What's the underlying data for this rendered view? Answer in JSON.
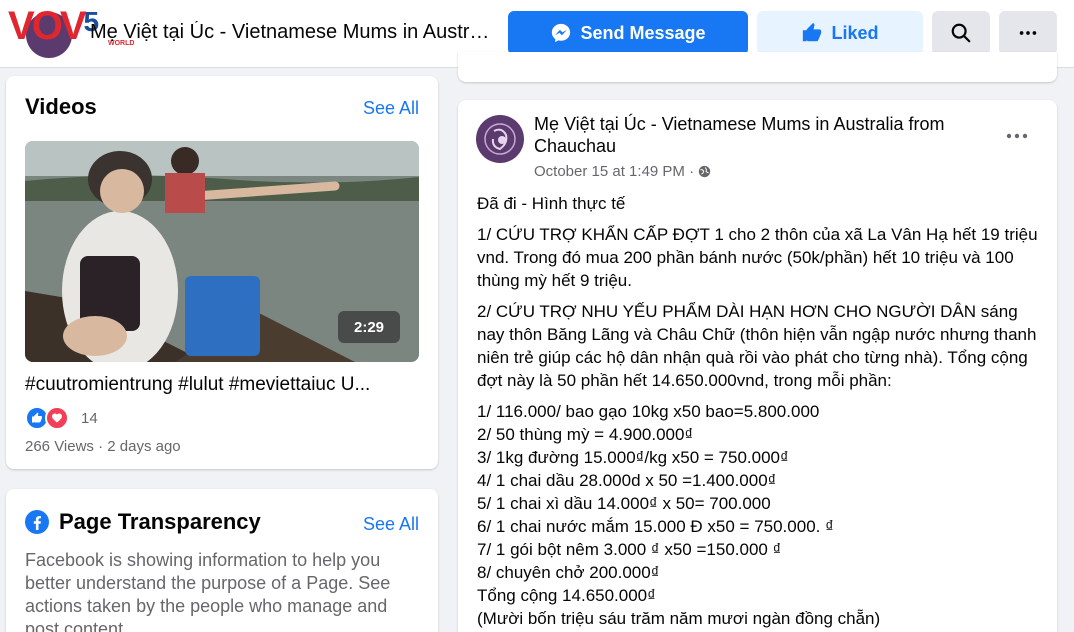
{
  "header": {
    "logo": {
      "part1": "V",
      "part2": "O",
      "part3": "V",
      "part4": "5",
      "sub": "WORLD"
    },
    "page_name": "Mẹ Việt tại Úc - Vietnamese Mums in Australia from Chauchau",
    "send_message_label": "Send Message",
    "liked_label": "Liked",
    "colors": {
      "primary": "#1877f2",
      "liked_bg": "#e7f3ff"
    }
  },
  "videos": {
    "title": "Videos",
    "see_all": "See All",
    "duration": "2:29",
    "video_title": "#cuutromientrung #lulut #meviettaiuc U...",
    "reaction_count": "14",
    "meta": "266 Views · 2 days ago"
  },
  "transparency": {
    "title": "Page Transparency",
    "see_all": "See All",
    "text": "Facebook is showing information to help you better understand the purpose of a Page. See actions taken by the people who manage and post content."
  },
  "post": {
    "author": "Mẹ Việt tại Úc - Vietnamese Mums in Australia from Chauchau",
    "time": "October 15 at 1:49 PM ·",
    "paragraphs": [
      "Đã đi - Hình thực tế",
      "1/ CỨU TRỢ KHẨN CẤP ĐỢT 1 cho 2 thôn của xã La Vân Hạ hết 19 triệu vnd. Trong đó mua 200 phần bánh nước (50k/phần) hết 10 triệu và 100 thùng mỳ hết 9 triệu.",
      "2/ CỨU TRỢ NHU YẾU PHẨM DÀI HẠN HƠN CHO NGƯỜI DÂN sáng nay thôn Băng Lãng và Châu Chữ (thôn hiện vẫn ngập nước nhưng thanh niên trẻ giúp các hộ dân nhận quà rồi vào phát cho từng nhà). Tổng cộng đợt này là 50 phần hết 14.650.000vnd, trong mỗi phần:"
    ],
    "items": [
      "1/ 116.000/ bao gạo 10kg x50 bao=5.800.000",
      "2/ 50 thùng mỳ = 4.900.000₫",
      "3/  1kg đường 15.000₫/kg x50 = 750.000₫",
      "4/  1 chai dầu 28.000d x 50 =1.400.000₫",
      "5/  1 chai xì dầu  14.000₫ x 50= 700.000",
      "6/ 1 chai nước mắm 15.000 Đ x50  = 750.000. ₫",
      "7/  1 gói bột nêm 3.000 ₫ x50  =150.000 ₫",
      "8/ chuyên chở 200.000₫",
      "Tổng cộng 14.650.000₫",
      "(Mười bốn triệu sáu trăm năm mươi ngàn đồng chẵn)"
    ]
  }
}
